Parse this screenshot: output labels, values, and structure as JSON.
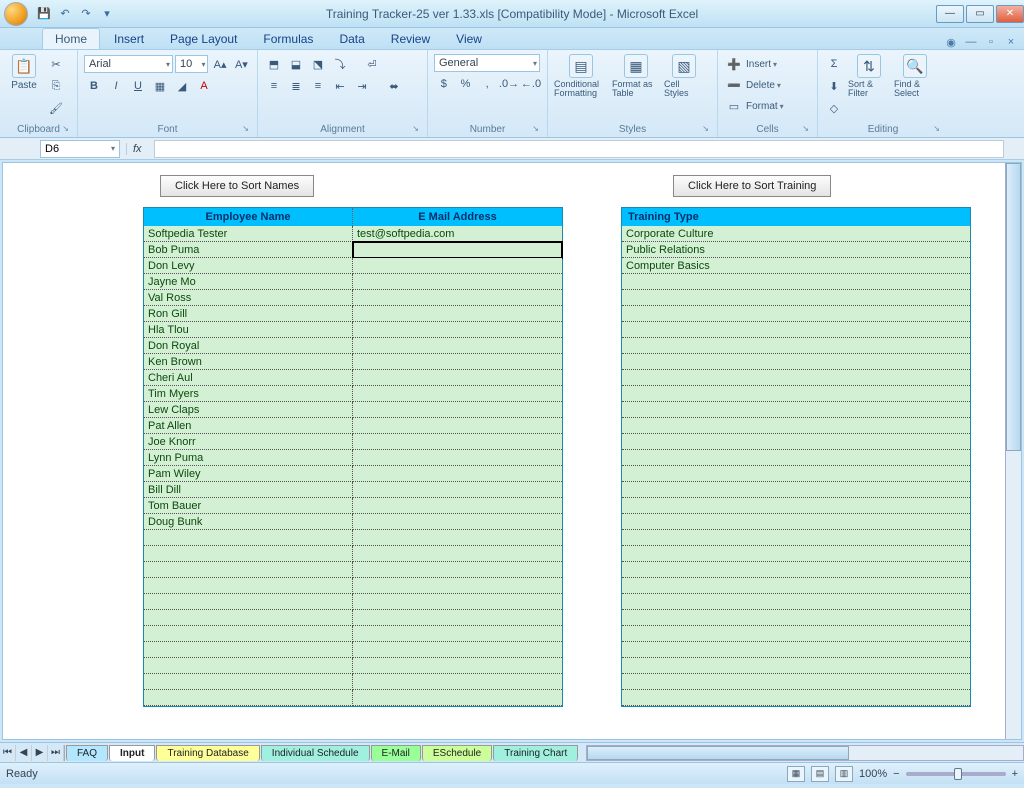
{
  "title": "Training Tracker-25 ver 1.33.xls [Compatibility Mode] - Microsoft Excel",
  "tabs": [
    "Home",
    "Insert",
    "Page Layout",
    "Formulas",
    "Data",
    "Review",
    "View"
  ],
  "active_tab": "Home",
  "ribbon": {
    "clipboard": {
      "label": "Clipboard",
      "paste": "Paste"
    },
    "font": {
      "label": "Font",
      "name": "Arial",
      "size": "10"
    },
    "alignment": {
      "label": "Alignment"
    },
    "number": {
      "label": "Number",
      "format": "General"
    },
    "styles": {
      "label": "Styles",
      "cond": "Conditional Formatting",
      "fmt": "Format as Table",
      "cell": "Cell Styles"
    },
    "cells": {
      "label": "Cells",
      "insert": "Insert",
      "delete": "Delete",
      "format": "Format"
    },
    "editing": {
      "label": "Editing",
      "sort": "Sort & Filter",
      "find": "Find & Select"
    }
  },
  "namebox": "D6",
  "buttons": {
    "sort_names": "Click Here to Sort Names",
    "sort_training": "Click Here to Sort Training"
  },
  "table1": {
    "h1": "Employee Name",
    "h2": "E Mail Address",
    "rows": [
      {
        "n": "Softpedia Tester",
        "e": "test@softpedia.com"
      },
      {
        "n": "Bob Puma",
        "e": ""
      },
      {
        "n": "Don Levy",
        "e": ""
      },
      {
        "n": "Jayne Mo",
        "e": ""
      },
      {
        "n": "Val Ross",
        "e": ""
      },
      {
        "n": "Ron Gill",
        "e": ""
      },
      {
        "n": "Hla Tlou",
        "e": ""
      },
      {
        "n": "Don Royal",
        "e": ""
      },
      {
        "n": "Ken Brown",
        "e": ""
      },
      {
        "n": "Cheri Aul",
        "e": ""
      },
      {
        "n": "Tim Myers",
        "e": ""
      },
      {
        "n": "Lew Claps",
        "e": ""
      },
      {
        "n": "Pat Allen",
        "e": ""
      },
      {
        "n": "Joe Knorr",
        "e": ""
      },
      {
        "n": "Lynn Puma",
        "e": ""
      },
      {
        "n": "Pam Wiley",
        "e": ""
      },
      {
        "n": "Bill Dill",
        "e": ""
      },
      {
        "n": "Tom Bauer",
        "e": ""
      },
      {
        "n": "Doug Bunk",
        "e": ""
      }
    ],
    "empty_rows": 11
  },
  "table2": {
    "h1": "Training Type",
    "rows": [
      "Corporate Culture",
      "Public Relations",
      "Computer Basics"
    ],
    "empty_rows": 27
  },
  "sheet_tabs": [
    "FAQ",
    "Input",
    "Training Database",
    "Individual Schedule",
    "E-Mail",
    "ESchedule",
    "Training Chart"
  ],
  "active_sheet": "Input",
  "status": {
    "left": "Ready",
    "zoom": "100%"
  }
}
